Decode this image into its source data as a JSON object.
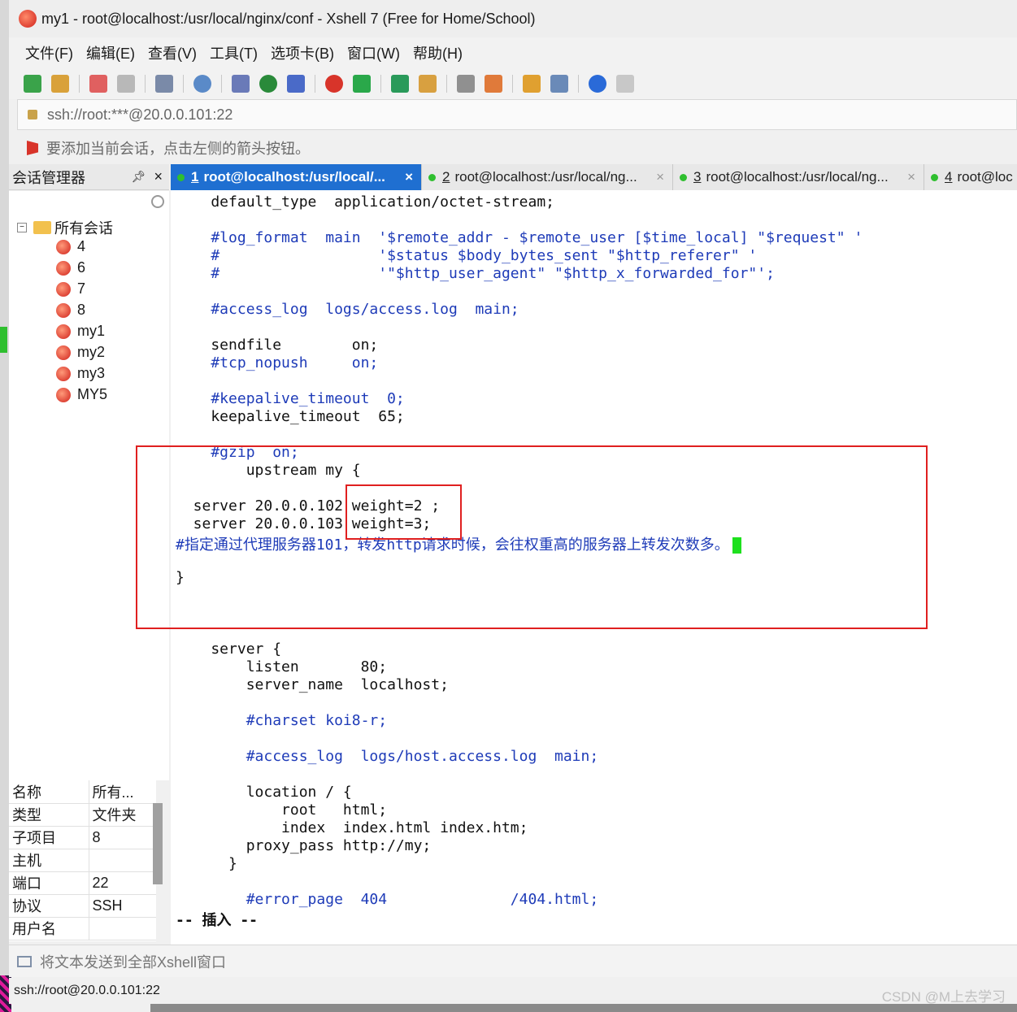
{
  "window": {
    "title": "my1 - root@localhost:/usr/local/nginx/conf - Xshell 7 (Free for Home/School)"
  },
  "menu": [
    "文件(F)",
    "编辑(E)",
    "查看(V)",
    "工具(T)",
    "选项卡(B)",
    "窗口(W)",
    "帮助(H)"
  ],
  "toolbar": {
    "icons": [
      "new-session-icon",
      "open-folder-icon",
      "disconnect-icon",
      "reconnect-icon",
      "properties-icon",
      "find-icon",
      "transfer-icon",
      "globe-icon",
      "font-icon",
      "xshell-icon",
      "xftp-icon",
      "fullscreen-icon",
      "lock-icon",
      "keyboard-icon",
      "highlight-icon",
      "new-folder-icon",
      "layout-icon",
      "help-icon",
      "chat-icon"
    ]
  },
  "address": {
    "value": "ssh://root:***@20.0.0.101:22"
  },
  "hint": {
    "text": "要添加当前会话，点击左侧的箭头按钮。"
  },
  "sidebar": {
    "title": "会话管理器",
    "pin": "ᵖ",
    "close": "×",
    "root_label": "所有会话",
    "sessions": [
      "4",
      "6",
      "7",
      "8",
      "my1",
      "my2",
      "my3",
      "MY5"
    ]
  },
  "properties": [
    {
      "key": "名称",
      "value": "所有..."
    },
    {
      "key": "类型",
      "value": "文件夹"
    },
    {
      "key": "子项目",
      "value": "8"
    },
    {
      "key": "主机",
      "value": ""
    },
    {
      "key": "端口",
      "value": "22"
    },
    {
      "key": "协议",
      "value": "SSH"
    },
    {
      "key": "用户名",
      "value": ""
    }
  ],
  "tabs": [
    {
      "num": "1",
      "label": "root@localhost:/usr/local/...",
      "active": true
    },
    {
      "num": "2",
      "label": "root@localhost:/usr/local/ng...",
      "active": false
    },
    {
      "num": "3",
      "label": "root@localhost:/usr/local/ng...",
      "active": false
    },
    {
      "num": "4",
      "label": "root@loc",
      "active": false
    }
  ],
  "terminal": {
    "lines": [
      {
        "text": "    default_type  application/octet-stream;",
        "color": "black"
      },
      {
        "text": "",
        "color": "black"
      },
      {
        "text": "    #log_format  main  '$remote_addr - $remote_user [$time_local] \"$request\" '",
        "color": "blue"
      },
      {
        "text": "    #                  '$status $body_bytes_sent \"$http_referer\" '",
        "color": "blue"
      },
      {
        "text": "    #                  '\"$http_user_agent\" \"$http_x_forwarded_for\"';",
        "color": "blue"
      },
      {
        "text": "",
        "color": "black"
      },
      {
        "text": "    #access_log  logs/access.log  main;",
        "color": "blue"
      },
      {
        "text": "",
        "color": "black"
      },
      {
        "text": "    sendfile        on;",
        "color": "black"
      },
      {
        "text": "    #tcp_nopush     on;",
        "color": "blue"
      },
      {
        "text": "",
        "color": "black"
      },
      {
        "text": "    #keepalive_timeout  0;",
        "color": "blue"
      },
      {
        "text": "    keepalive_timeout  65;",
        "color": "black"
      },
      {
        "text": "",
        "color": "black"
      },
      {
        "text": "    #gzip  on;",
        "color": "blue"
      },
      {
        "text": "        upstream my {",
        "color": "black"
      },
      {
        "text": "",
        "color": "black"
      },
      {
        "text": "  server 20.0.0.102 weight=2 ;",
        "color": "black"
      },
      {
        "text": "  server 20.0.0.103 weight=3;",
        "color": "black"
      },
      {
        "text": "#指定通过代理服务器101，转发http请求时候，会往权重高的服务器上转发次数多。",
        "color": "blue",
        "cursor": true
      },
      {
        "text": "",
        "color": "black"
      },
      {
        "text": "}",
        "color": "black"
      },
      {
        "text": "",
        "color": "black"
      },
      {
        "text": "",
        "color": "black"
      },
      {
        "text": "",
        "color": "black"
      },
      {
        "text": "    server {",
        "color": "black"
      },
      {
        "text": "        listen       80;",
        "color": "black"
      },
      {
        "text": "        server_name  localhost;",
        "color": "black"
      },
      {
        "text": "",
        "color": "black"
      },
      {
        "text": "        #charset koi8-r;",
        "color": "blue"
      },
      {
        "text": "",
        "color": "black"
      },
      {
        "text": "        #access_log  logs/host.access.log  main;",
        "color": "blue"
      },
      {
        "text": "",
        "color": "black"
      },
      {
        "text": "        location / {",
        "color": "black"
      },
      {
        "text": "            root   html;",
        "color": "black"
      },
      {
        "text": "            index  index.html index.htm;",
        "color": "black"
      },
      {
        "text": "        proxy_pass http://my;",
        "color": "black"
      },
      {
        "text": "      }",
        "color": "black"
      },
      {
        "text": "",
        "color": "black"
      },
      {
        "text": "        #error_page  404              /404.html;",
        "color": "blue"
      },
      {
        "text": "-- 插入 --",
        "color": "black",
        "bold": true
      }
    ]
  },
  "send_bar": {
    "text": "将文本发送到全部Xshell窗口"
  },
  "status": {
    "text": "ssh://root@20.0.0.101:22"
  },
  "watermark": {
    "text": "CSDN @M上去学习"
  },
  "colors": {
    "active_tab": "#1f6fd1",
    "comment": "#1e3bb8",
    "cursor": "#1ee01e",
    "highlight_box": "#e02020"
  }
}
